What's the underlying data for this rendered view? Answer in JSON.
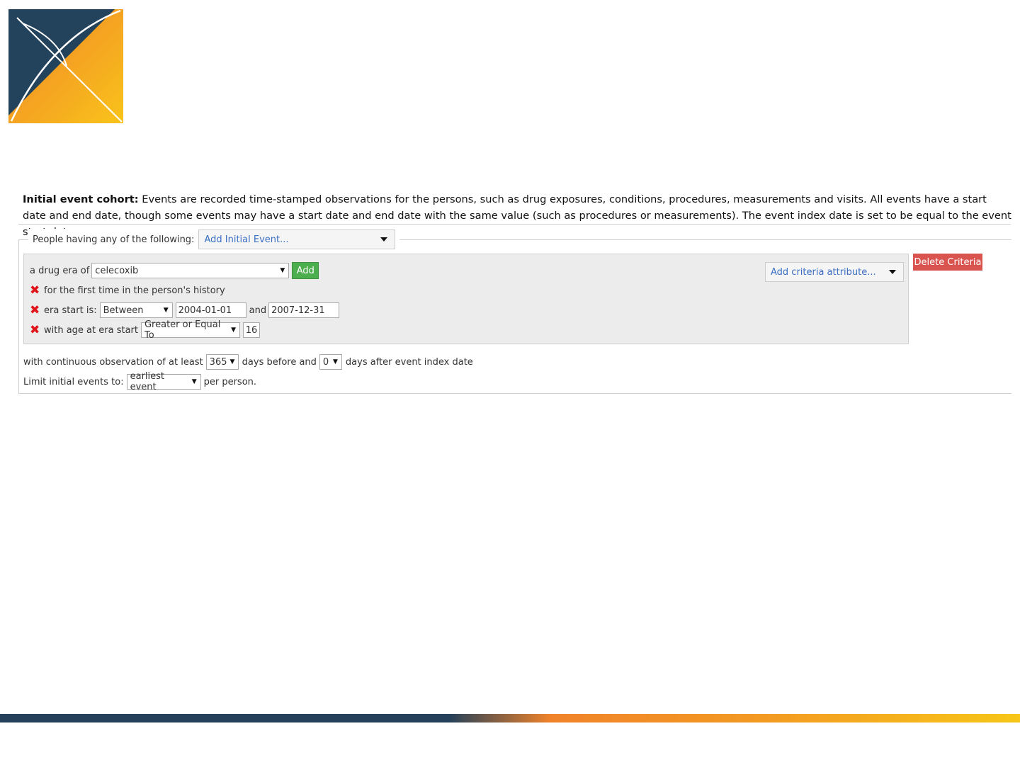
{
  "intro": {
    "label": "Initial event cohort:",
    "text": "Events are recorded time-stamped observations for the persons, such as drug exposures, conditions, procedures, measurements and visits. All events have a start date and end date, though some events may have a start date and end date with the same value (such as procedures or measurements). The event index date is set to be equal to the event start date."
  },
  "legend": {
    "label": "People having any of the following:",
    "select": "Add Initial Event..."
  },
  "criteria": {
    "drug_prefix": "a drug era of",
    "drug_value": "celecoxib",
    "add_label": "Add",
    "attr_select": "Add criteria attribute...",
    "delete_label": "Delete Criteria",
    "first_time": "for the first time in the person's history",
    "era_start_label": "era start is:",
    "era_start_op": "Between",
    "era_start_from": "2004-01-01",
    "era_start_and": "and",
    "era_start_to": "2007-12-31",
    "age_label": "with age at era start",
    "age_op": "Greater or Equal To",
    "age_value": "16"
  },
  "observation": {
    "prefix": "with continuous observation of at least",
    "before_value": "365",
    "mid": "days before and",
    "after_value": "0",
    "suffix": "days after event index date"
  },
  "limit": {
    "prefix": "Limit initial events to:",
    "value": "earliest event",
    "suffix": "per person."
  },
  "colors": {
    "delete": "#d9534f",
    "add": "#4cae4c",
    "link": "#3a6fc4",
    "remove": "#e0141b"
  }
}
